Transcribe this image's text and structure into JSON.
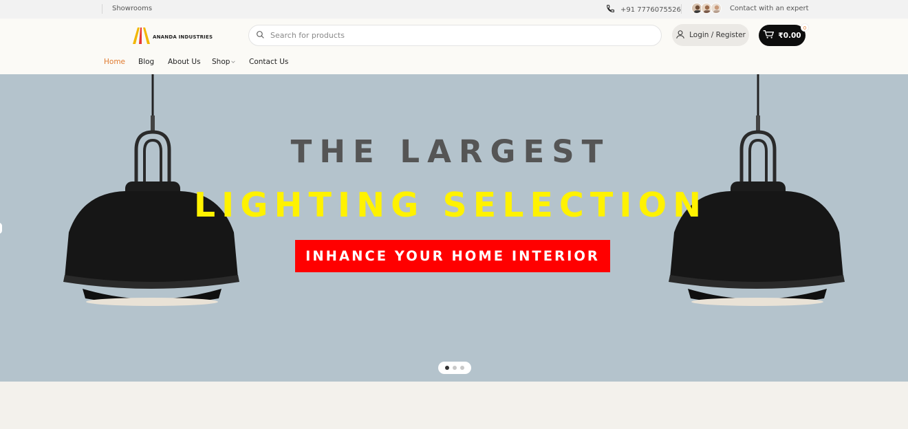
{
  "topbar": {
    "showrooms": "Showrooms",
    "phone": "+91 7776075526",
    "contact": "Contact with an expert"
  },
  "header": {
    "logo_text": "ANANDA INDUSTRIES",
    "search_placeholder": "Search for products",
    "login_label": "Login / Register",
    "cart_total": "₹0.00",
    "cart_count": "0"
  },
  "nav": {
    "items": [
      {
        "label": "Home"
      },
      {
        "label": "Blog"
      },
      {
        "label": "About Us"
      },
      {
        "label": "Shop"
      },
      {
        "label": "Contact Us"
      }
    ]
  },
  "hero": {
    "line1": "THE LARGEST",
    "line2": "LIGHTING SELECTION",
    "cta": "INHANCE YOUR HOME INTERIOR",
    "slides": 3,
    "active_slide": 1
  },
  "colors": {
    "accent": "#e07a2f",
    "hero_bg": "#b4c3cc",
    "headline_yellow": "#fff200",
    "cta_red": "#ff0000"
  }
}
